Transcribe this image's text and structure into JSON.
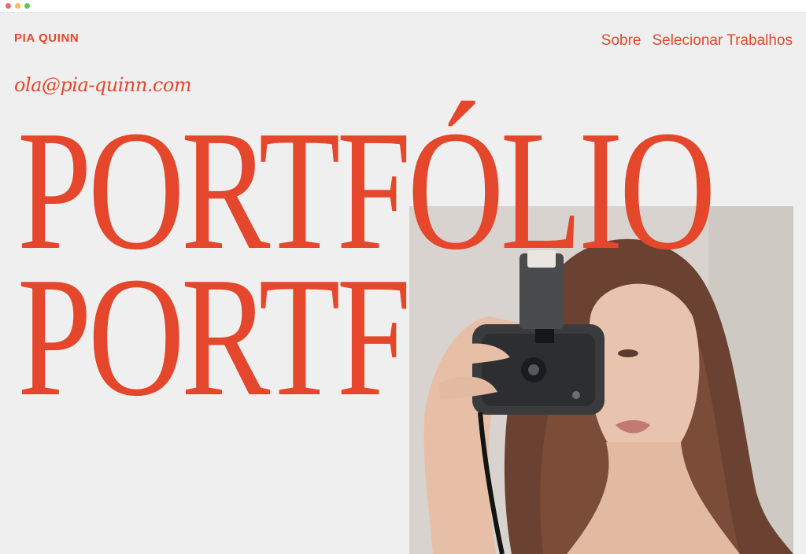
{
  "browser": {
    "dots": [
      "#ee6a5f",
      "#f5be4f",
      "#61c454"
    ]
  },
  "brand": {
    "name": "PIA QUINN"
  },
  "nav": {
    "items": [
      {
        "label": "Sobre"
      },
      {
        "label": "Selecionar Trabalhos"
      }
    ]
  },
  "contact": {
    "email": "ola@pia-quinn.com"
  },
  "hero": {
    "line1": "PORTFÓLIO",
    "line2": "PORTF"
  },
  "colors": {
    "accent": "#e4472b",
    "background": "#f0efef"
  },
  "photo": {
    "subject": "woman holding a camera in front of her face"
  }
}
